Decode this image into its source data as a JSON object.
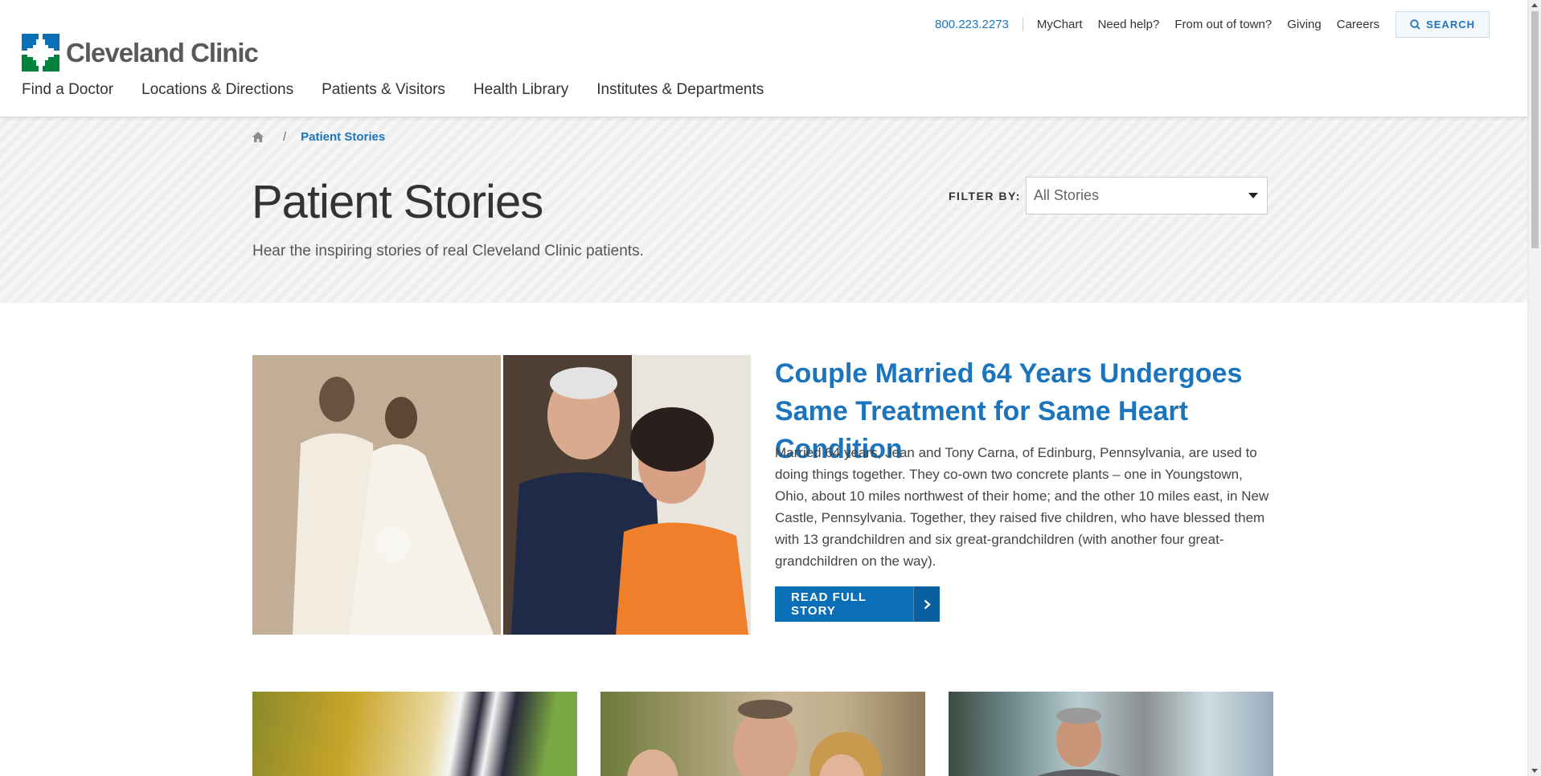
{
  "brand": {
    "name": "Cleveland Clinic",
    "colors": {
      "blue": "#0b6fb8",
      "green": "#00843d",
      "link": "#1c75bc"
    }
  },
  "utility_nav": {
    "phone": "800.223.2273",
    "links": [
      "MyChart",
      "Need help?",
      "From out of town?",
      "Giving",
      "Careers"
    ],
    "search_label": "SEARCH"
  },
  "main_nav": [
    "Find a Doctor",
    "Locations & Directions",
    "Patients & Visitors",
    "Health Library",
    "Institutes & Departments"
  ],
  "breadcrumb": {
    "separator": "/",
    "current": "Patient Stories"
  },
  "hero": {
    "title": "Patient Stories",
    "subtitle": "Hear the inspiring stories of real Cleveland Clinic patients.",
    "filter_label": "FILTER BY:",
    "filter_value": "All Stories"
  },
  "featured": {
    "title": "Couple Married 64 Years Undergoes Same Treatment for Same Heart Condition",
    "body": "Married 64 years, Jean and Tony Carna, of Edinburg, Pennsylvania, are used to doing things together. They co-own two concrete plants – one in Youngstown, Ohio, about 10 miles northwest of their home; and the other 10 miles east, in New Castle, Pennsylvania. Together, they raised five children, who have blessed them with 13 grandchildren and six great-grandchildren (with another four great-grandchildren on the way).",
    "button": "READ FULL STORY"
  }
}
